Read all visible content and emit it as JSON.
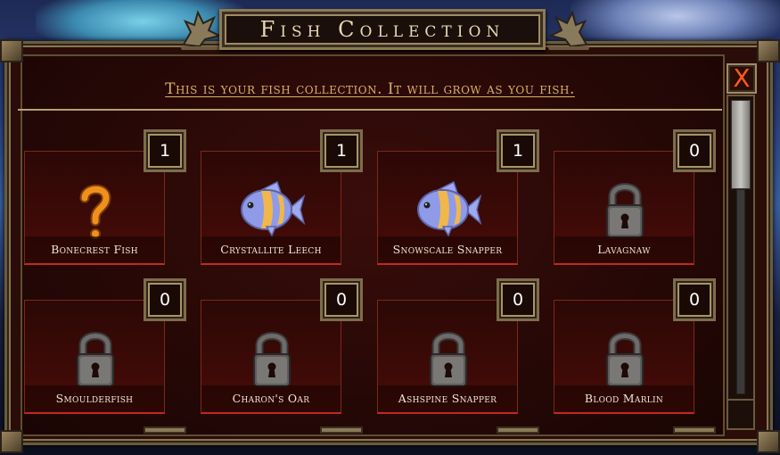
{
  "window": {
    "title": "Fish Collection",
    "subtitle": "This is your fish collection. It will grow as you fish.",
    "close_label": "X"
  },
  "collection": [
    {
      "name": "Bonecrest Fish",
      "count": "1",
      "icon": "question-mark-icon"
    },
    {
      "name": "Crystallite Leech",
      "count": "1",
      "icon": "fish-icon"
    },
    {
      "name": "Snowscale Snapper",
      "count": "1",
      "icon": "fish-icon"
    },
    {
      "name": "Lavagnaw",
      "count": "0",
      "icon": "padlock-icon"
    },
    {
      "name": "Smoulderfish",
      "count": "0",
      "icon": "padlock-icon"
    },
    {
      "name": "Charon's Oar",
      "count": "0",
      "icon": "padlock-icon"
    },
    {
      "name": "Ashspine Snapper",
      "count": "0",
      "icon": "padlock-icon"
    },
    {
      "name": "Blood Marlin",
      "count": "0",
      "icon": "padlock-icon"
    }
  ],
  "colors": {
    "accent_gold": "#d7b06a",
    "close_x": "#ff5a1a",
    "card_border": "#c02a1c",
    "fish_body": "#8f9be8",
    "fish_stripe": "#f0b84a",
    "question_mark": "#f0901c"
  }
}
